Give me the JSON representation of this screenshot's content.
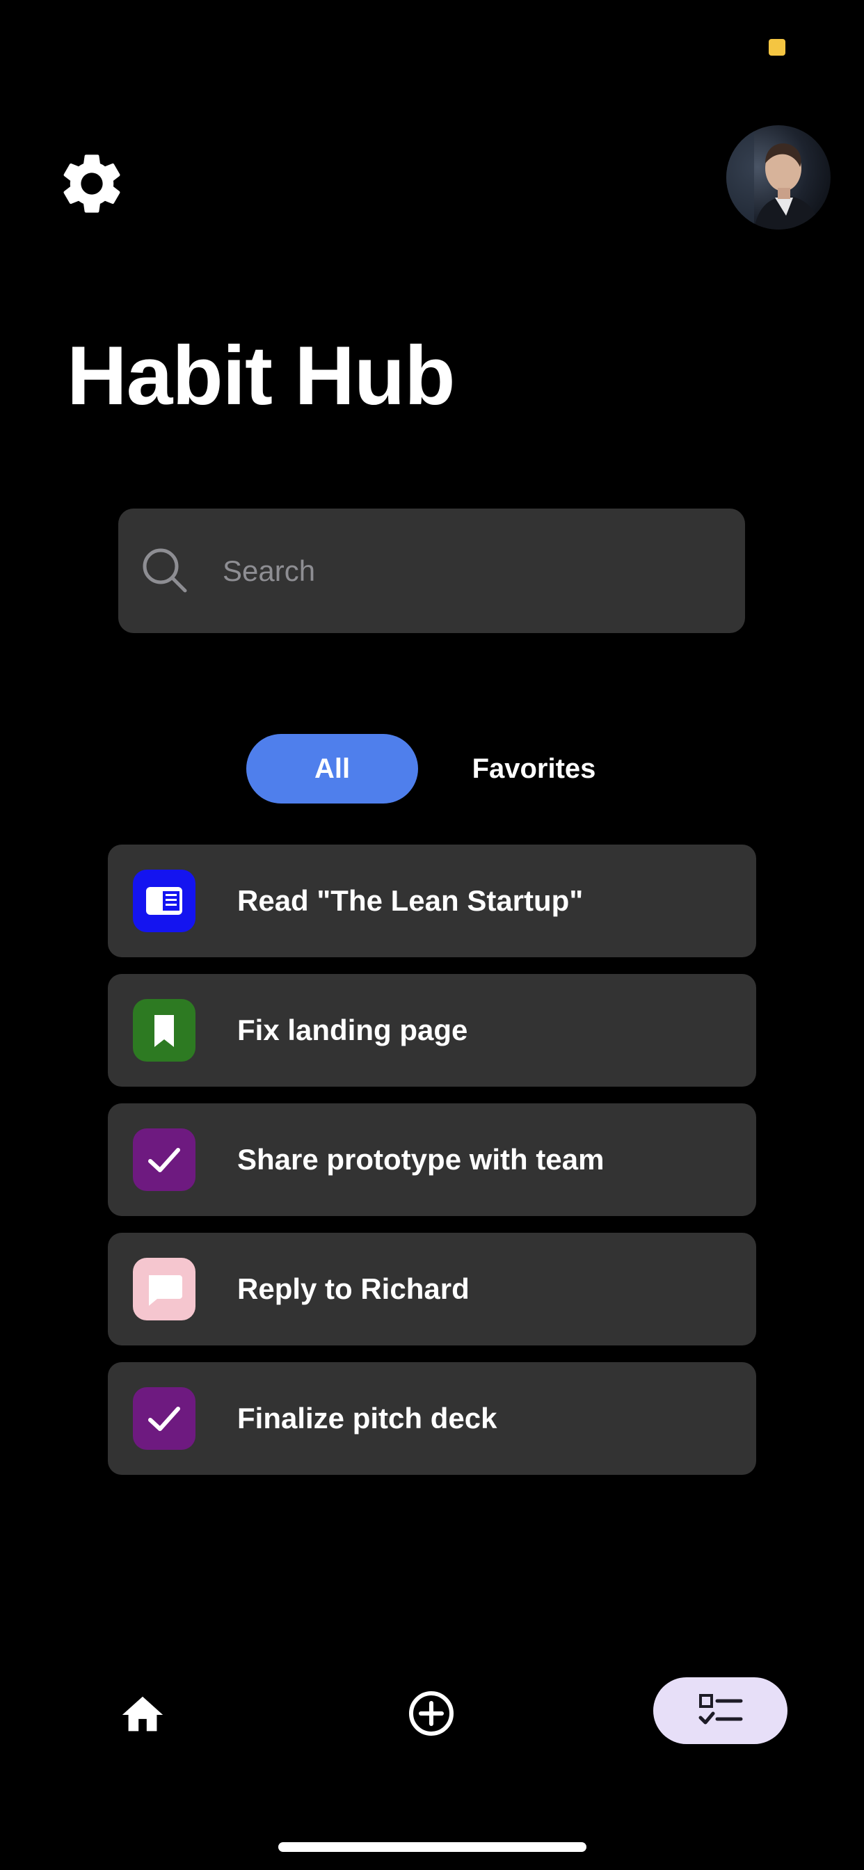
{
  "colors": {
    "background": "#000000",
    "surface": "#333333",
    "accent_tab": "#4f7fec",
    "nav_active": "#e7dff8",
    "status_dot": "#f4c542"
  },
  "header": {
    "settings_icon": "gear-icon",
    "avatar": "profile-photo"
  },
  "title": "Habit Hub",
  "search": {
    "placeholder": "Search",
    "value": "",
    "icon": "search-icon"
  },
  "tabs": [
    {
      "label": "All",
      "selected": true
    },
    {
      "label": "Favorites",
      "selected": false
    }
  ],
  "habits": [
    {
      "label": "Read \"The Lean Startup\"",
      "icon": "book-icon",
      "icon_color": "#1414f0"
    },
    {
      "label": "Fix landing page",
      "icon": "bookmark-icon",
      "icon_color": "#2d7a22"
    },
    {
      "label": "Share prototype with team",
      "icon": "check-icon",
      "icon_color": "#6e1a80"
    },
    {
      "label": "Reply to Richard",
      "icon": "chat-bubble-icon",
      "icon_color": "#f5c6cf"
    },
    {
      "label": "Finalize pitch deck",
      "icon": "check-icon",
      "icon_color": "#6e1a80"
    }
  ],
  "bottom_nav": [
    {
      "icon": "home-icon",
      "active": false
    },
    {
      "icon": "add-circle-icon",
      "active": false
    },
    {
      "icon": "checklist-icon",
      "active": true
    }
  ]
}
